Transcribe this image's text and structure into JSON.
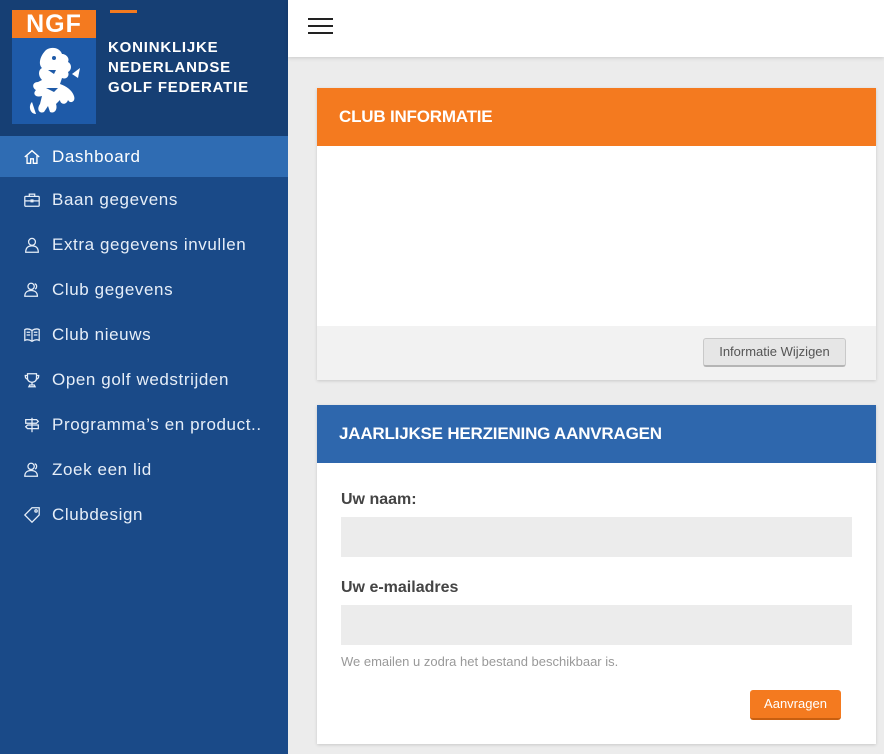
{
  "logo": {
    "abbr": "NGF",
    "lines": [
      "KONINKLIJKE",
      "NEDERLANDSE",
      "GOLF FEDERATIE"
    ]
  },
  "sidebar": {
    "items": [
      {
        "label": "Dashboard",
        "icon": "home-icon",
        "active": true
      },
      {
        "label": "Baan gegevens",
        "icon": "briefcase-icon"
      },
      {
        "label": "Extra gegevens invullen",
        "icon": "user-icon"
      },
      {
        "label": "Club gegevens",
        "icon": "users-icon"
      },
      {
        "label": "Club nieuws",
        "icon": "book-icon"
      },
      {
        "label": "Open golf wedstrijden",
        "icon": "trophy-icon"
      },
      {
        "label": "Programma’s en product..",
        "icon": "signpost-icon"
      },
      {
        "label": "Zoek een lid",
        "icon": "users-search-icon"
      },
      {
        "label": "Clubdesign",
        "icon": "tag-icon"
      }
    ]
  },
  "club_info": {
    "title": "CLUB INFORMATIE",
    "edit_button": "Informatie Wijzigen"
  },
  "review": {
    "title": "JAARLIJKSE HERZIENING AANVRAGEN",
    "name_label": "Uw naam:",
    "name_value": "",
    "email_label": "Uw e-mailadres",
    "email_value": "",
    "hint": "We emailen u zodra het bestand beschikbaar is.",
    "submit_button": "Aanvragen"
  },
  "colors": {
    "sidebar": "#1a4a88",
    "active_item": "#2f6cb3",
    "orange": "#f47a1f",
    "blue_header": "#2e67ad"
  }
}
